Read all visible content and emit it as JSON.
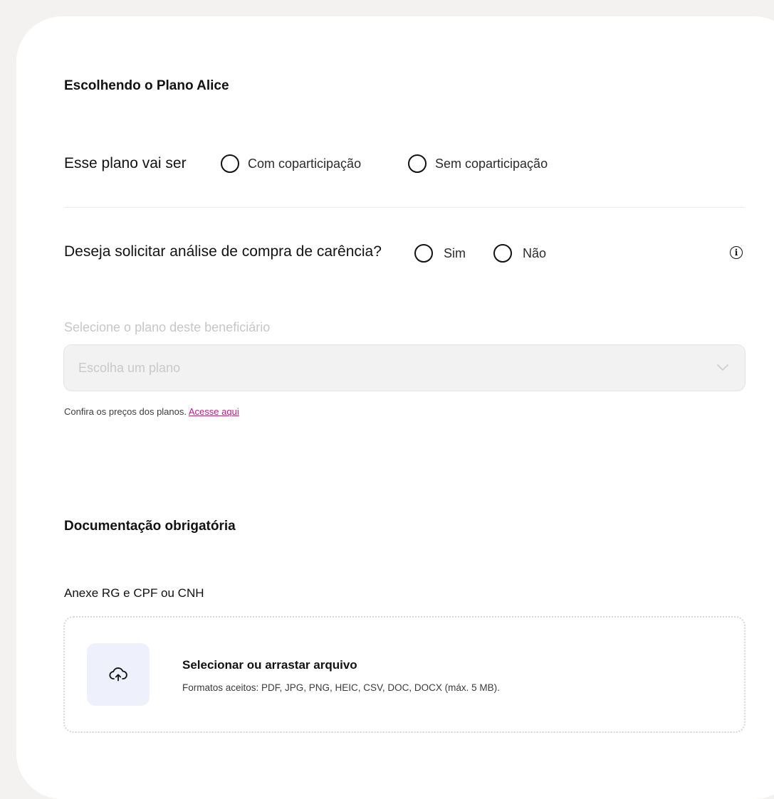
{
  "plan_section": {
    "title": "Escolhendo o Plano Alice",
    "plan_type": {
      "question": "Esse plano vai ser",
      "options": [
        "Com coparticipação",
        "Sem coparticipação"
      ]
    },
    "carencia": {
      "question": "Deseja solicitar análise de compra de carência?",
      "options": [
        "Sim",
        "Não"
      ]
    },
    "plan_select": {
      "label": "Selecione o plano deste beneficiário",
      "placeholder": "Escolha um plano"
    },
    "helper": {
      "text": "Confira os preços dos planos.",
      "link": "Acesse aqui"
    }
  },
  "docs_section": {
    "title": "Documentação obrigatória",
    "upload_label": "Anexe RG e CPF ou CNH",
    "upload": {
      "title": "Selecionar ou arrastar arquivo",
      "formats": "Formatos aceitos: PDF, JPG, PNG, HEIC, CSV, DOC, DOCX (máx. 5 MB)."
    }
  },
  "colors": {
    "background": "#f3f2f0",
    "card": "#ffffff",
    "link": "#c4178a",
    "upload_icon_bg": "#eef1fb"
  }
}
